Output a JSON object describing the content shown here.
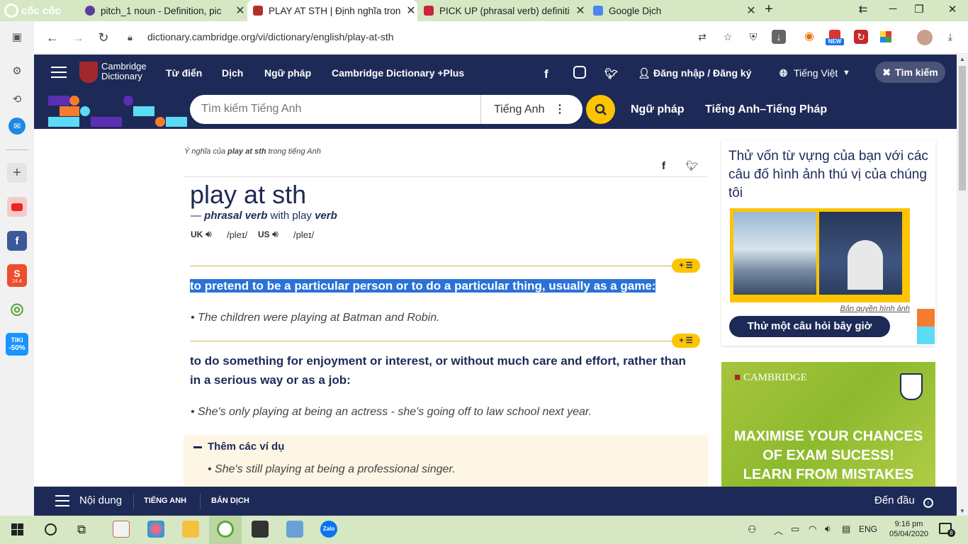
{
  "browser": {
    "brand": "cốc cốc",
    "tabs": [
      {
        "title": "pitch_1 noun - Definition, pic",
        "active": false
      },
      {
        "title": "PLAY AT STH | Định nghĩa tron",
        "active": true
      },
      {
        "title": "PICK UP (phrasal verb) definiti",
        "active": false
      },
      {
        "title": "Google Dịch",
        "active": false
      }
    ],
    "url": "dictionary.cambridge.org/vi/dictionary/english/play-at-sth",
    "new_badge": "NEW"
  },
  "sidebar_badges": {
    "shopee": "24.4",
    "tiki": "TIKI",
    "tiki_discount": "-50%"
  },
  "cambridge": {
    "logo_line1": "Cambridge",
    "logo_line2": "Dictionary",
    "nav": [
      "Từ điển",
      "Dịch",
      "Ngữ pháp",
      "Cambridge Dictionary +Plus"
    ],
    "login": "Đăng nhập / Đăng ký",
    "language": "Tiếng Việt",
    "search_toggle": "Tìm kiếm",
    "search_placeholder": "Tìm kiếm Tiếng Anh",
    "search_lang": "Tiếng Anh",
    "subnav": [
      "Ngữ pháp",
      "Tiếng Anh–Tiếng Pháp"
    ]
  },
  "entry": {
    "meta_prefix": "Ý nghĩa của ",
    "meta_word": "play at sth",
    "meta_suffix": " trong tiếng Anh",
    "headword": "play at sth",
    "pos_dash": "— ",
    "pos": "phrasal verb",
    "pos_with": " with play ",
    "pos_verb": "verb",
    "uk_label": "UK",
    "us_label": "US",
    "uk_ipa": "/pleɪ/",
    "us_ipa": "/pleɪ/",
    "badge": "+ ☰",
    "sense1_def": "to pretend to be a particular person or to do a particular thing, usually as a game:",
    "sense1_ex": "The children were playing at Batman and Robin.",
    "sense2_def": "to do something for enjoyment or interest, or without much care and effort, rather than in a serious way or as a job:",
    "sense2_ex": "She's only playing at being an actress - she's going off to law school next year.",
    "more_title": "Thêm các ví dụ",
    "more_ex1": "She's still playing at being a professional singer."
  },
  "quiz": {
    "title": "Thử vốn từ vựng của bạn với các câu đố hình ảnh thú vị của chúng tôi",
    "credit": "Bản quyền hình ảnh",
    "button": "Thử một câu hỏi bây giờ"
  },
  "ad": {
    "brand": "CAMBRIDGE",
    "line1": "MAXIMISE YOUR CHANCES",
    "line2": "OF EXAM SUCESS!",
    "line3": "LEARN FROM MISTAKES"
  },
  "bottom_nav": {
    "contents": "Nội dung",
    "english": "TIẾNG ANH",
    "translation": "BẢN DỊCH",
    "top": "Đến đầu"
  },
  "taskbar": {
    "time": "9:16 pm",
    "date": "05/04/2020",
    "lang": "ENG",
    "notif": "8"
  },
  "colors": {
    "cambridge_navy": "#1d2a57",
    "accent_yellow": "#fec400",
    "selection_blue": "#2a72d8",
    "coccoc_green": "#d6e7c4"
  }
}
